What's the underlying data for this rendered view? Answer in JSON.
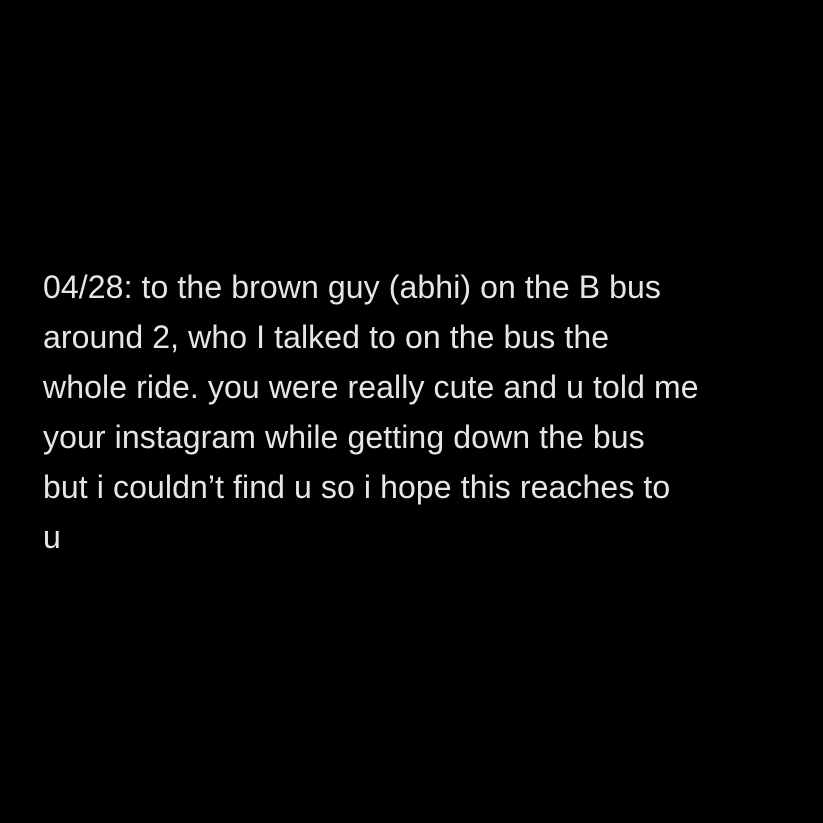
{
  "post": {
    "lines": [
      "04/28: to the brown guy (abhi) on the B bus",
      "around 2, who I talked to on the bus the",
      "whole ride. you were really cute and u told me",
      "your instagram while getting down the bus",
      "but i couldn’t find u so i hope this reaches to",
      "u"
    ]
  },
  "colors": {
    "background": "#000000",
    "text": "#e6e6e6"
  }
}
